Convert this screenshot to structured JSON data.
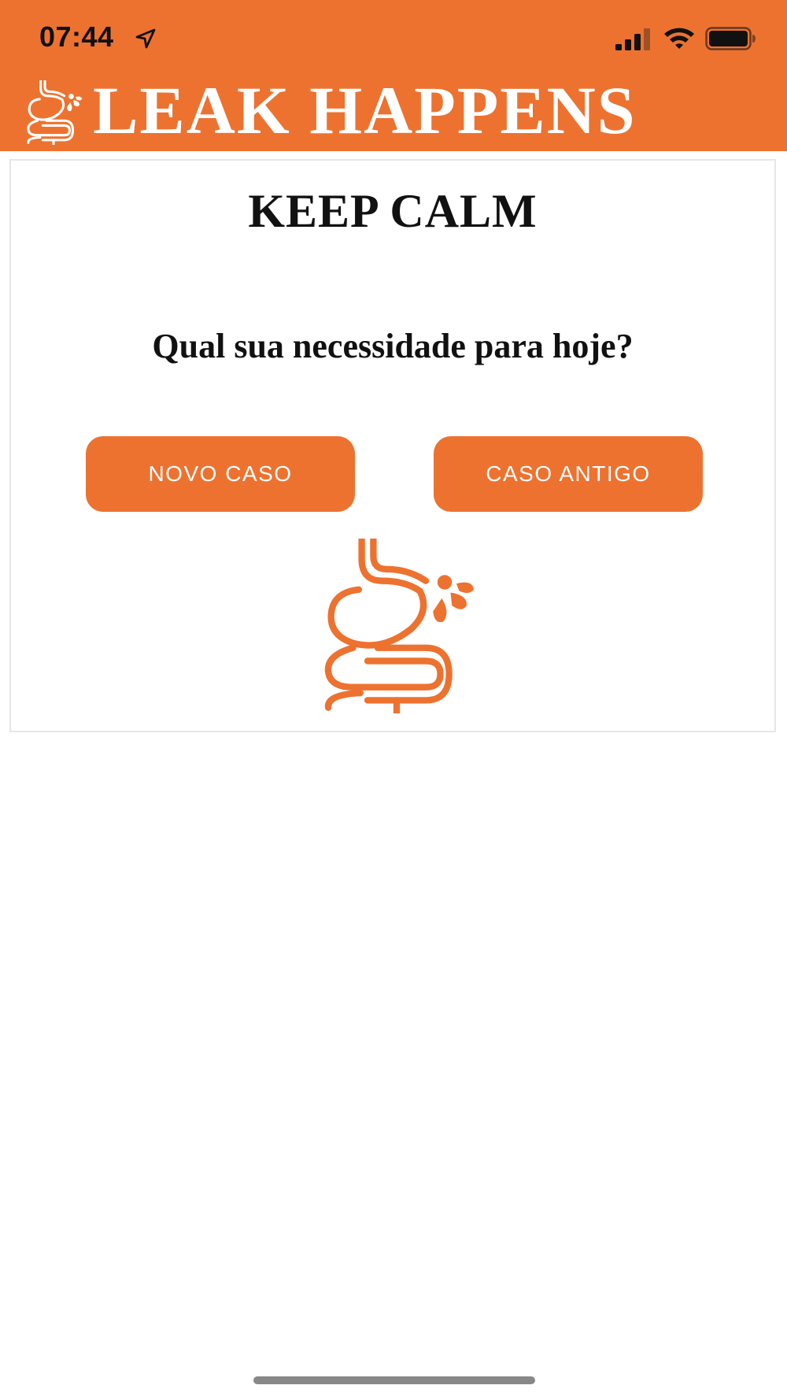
{
  "colors": {
    "brand_orange": "#ED7230",
    "text_dark": "#111111",
    "card_border": "#E6E6E6",
    "home_indicator": "#888888"
  },
  "status_bar": {
    "time": "07:44",
    "icons": [
      "location-arrow-icon",
      "cellular-signal-icon",
      "wifi-icon",
      "battery-icon"
    ]
  },
  "header": {
    "logo_icon": "digestive-tract-leak-icon",
    "title": "LEAK HAPPENS"
  },
  "card": {
    "title": "KEEP CALM",
    "question": "Qual sua necessidade para hoje?",
    "buttons": {
      "new_case": "NOVO CASO",
      "old_case": "CASO ANTIGO"
    },
    "illustration_icon": "digestive-tract-leak-icon"
  }
}
